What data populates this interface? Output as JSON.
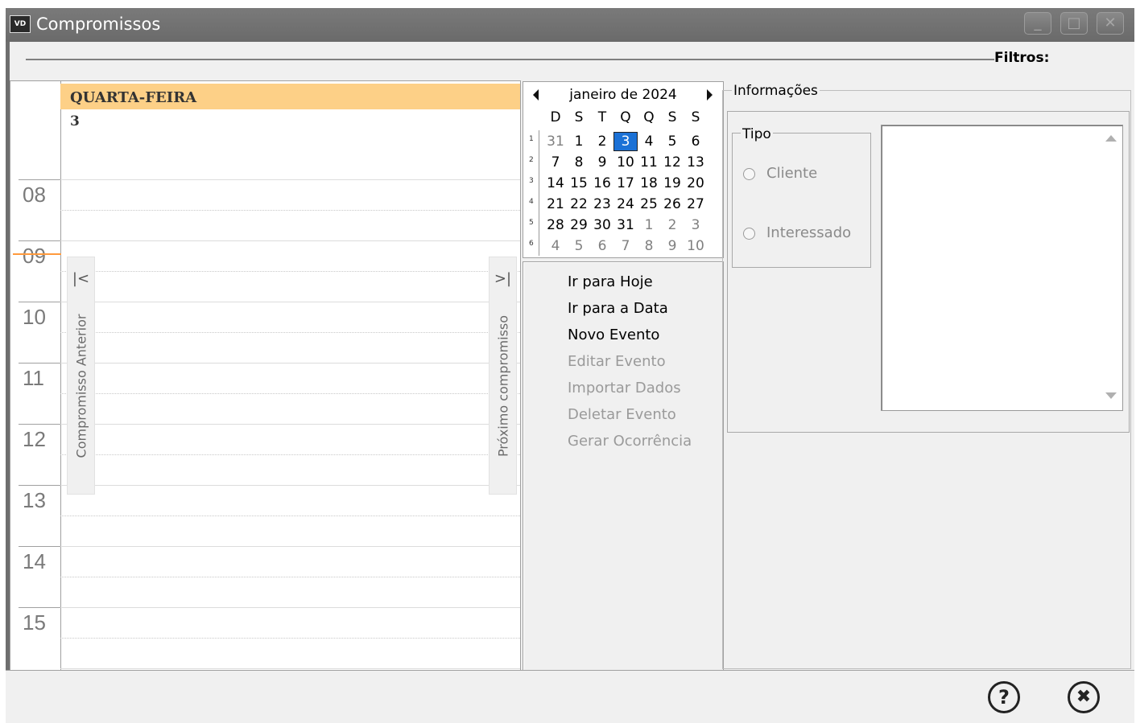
{
  "window": {
    "app_badge": "VD",
    "title": "Compromissos",
    "minimize_glyph": "_",
    "maximize_glyph": "□",
    "close_glyph": "✕"
  },
  "filters": {
    "label": "Filtros:"
  },
  "day_view": {
    "day_name": "QUARTA-FEIRA",
    "day_number": "3",
    "hours": [
      "08",
      "09",
      "10",
      "11",
      "12",
      "13",
      "14",
      "15"
    ],
    "prev_tab": {
      "arrow": "|<",
      "label": "Compromisso Anterior"
    },
    "next_tab": {
      "arrow": ">|",
      "label": "Próximo compromisso"
    }
  },
  "mini_calendar": {
    "title": "janeiro de 2024",
    "weekdays": [
      "D",
      "S",
      "T",
      "Q",
      "Q",
      "S",
      "S"
    ],
    "week_numbers": [
      "1",
      "2",
      "3",
      "4",
      "5",
      "6"
    ],
    "weeks": [
      [
        "31",
        "1",
        "2",
        "3",
        "4",
        "5",
        "6"
      ],
      [
        "7",
        "8",
        "9",
        "10",
        "11",
        "12",
        "13"
      ],
      [
        "14",
        "15",
        "16",
        "17",
        "18",
        "19",
        "20"
      ],
      [
        "21",
        "22",
        "23",
        "24",
        "25",
        "26",
        "27"
      ],
      [
        "28",
        "29",
        "30",
        "31",
        "1",
        "2",
        "3"
      ],
      [
        "4",
        "5",
        "6",
        "7",
        "8",
        "9",
        "10"
      ]
    ],
    "selected_day": "3",
    "selection_color": "#1b71d6"
  },
  "actions": [
    {
      "label": "Ir para Hoje",
      "enabled": true
    },
    {
      "label": "Ir para a Data",
      "enabled": true
    },
    {
      "label": "Novo Evento",
      "enabled": true
    },
    {
      "label": "Editar Evento",
      "enabled": false
    },
    {
      "label": "Importar Dados",
      "enabled": false
    },
    {
      "label": "Deletar Evento",
      "enabled": false
    },
    {
      "label": "Gerar Ocorrência",
      "enabled": false
    }
  ],
  "info": {
    "legend": "Informações",
    "tipo": {
      "legend": "Tipo",
      "options": [
        "Cliente",
        "Interessado"
      ]
    }
  },
  "footer": {
    "help_glyph": "?",
    "close_glyph": "✖"
  },
  "colors": {
    "day_header": "#fdd087",
    "current_time_line": "#ff9a3c"
  }
}
